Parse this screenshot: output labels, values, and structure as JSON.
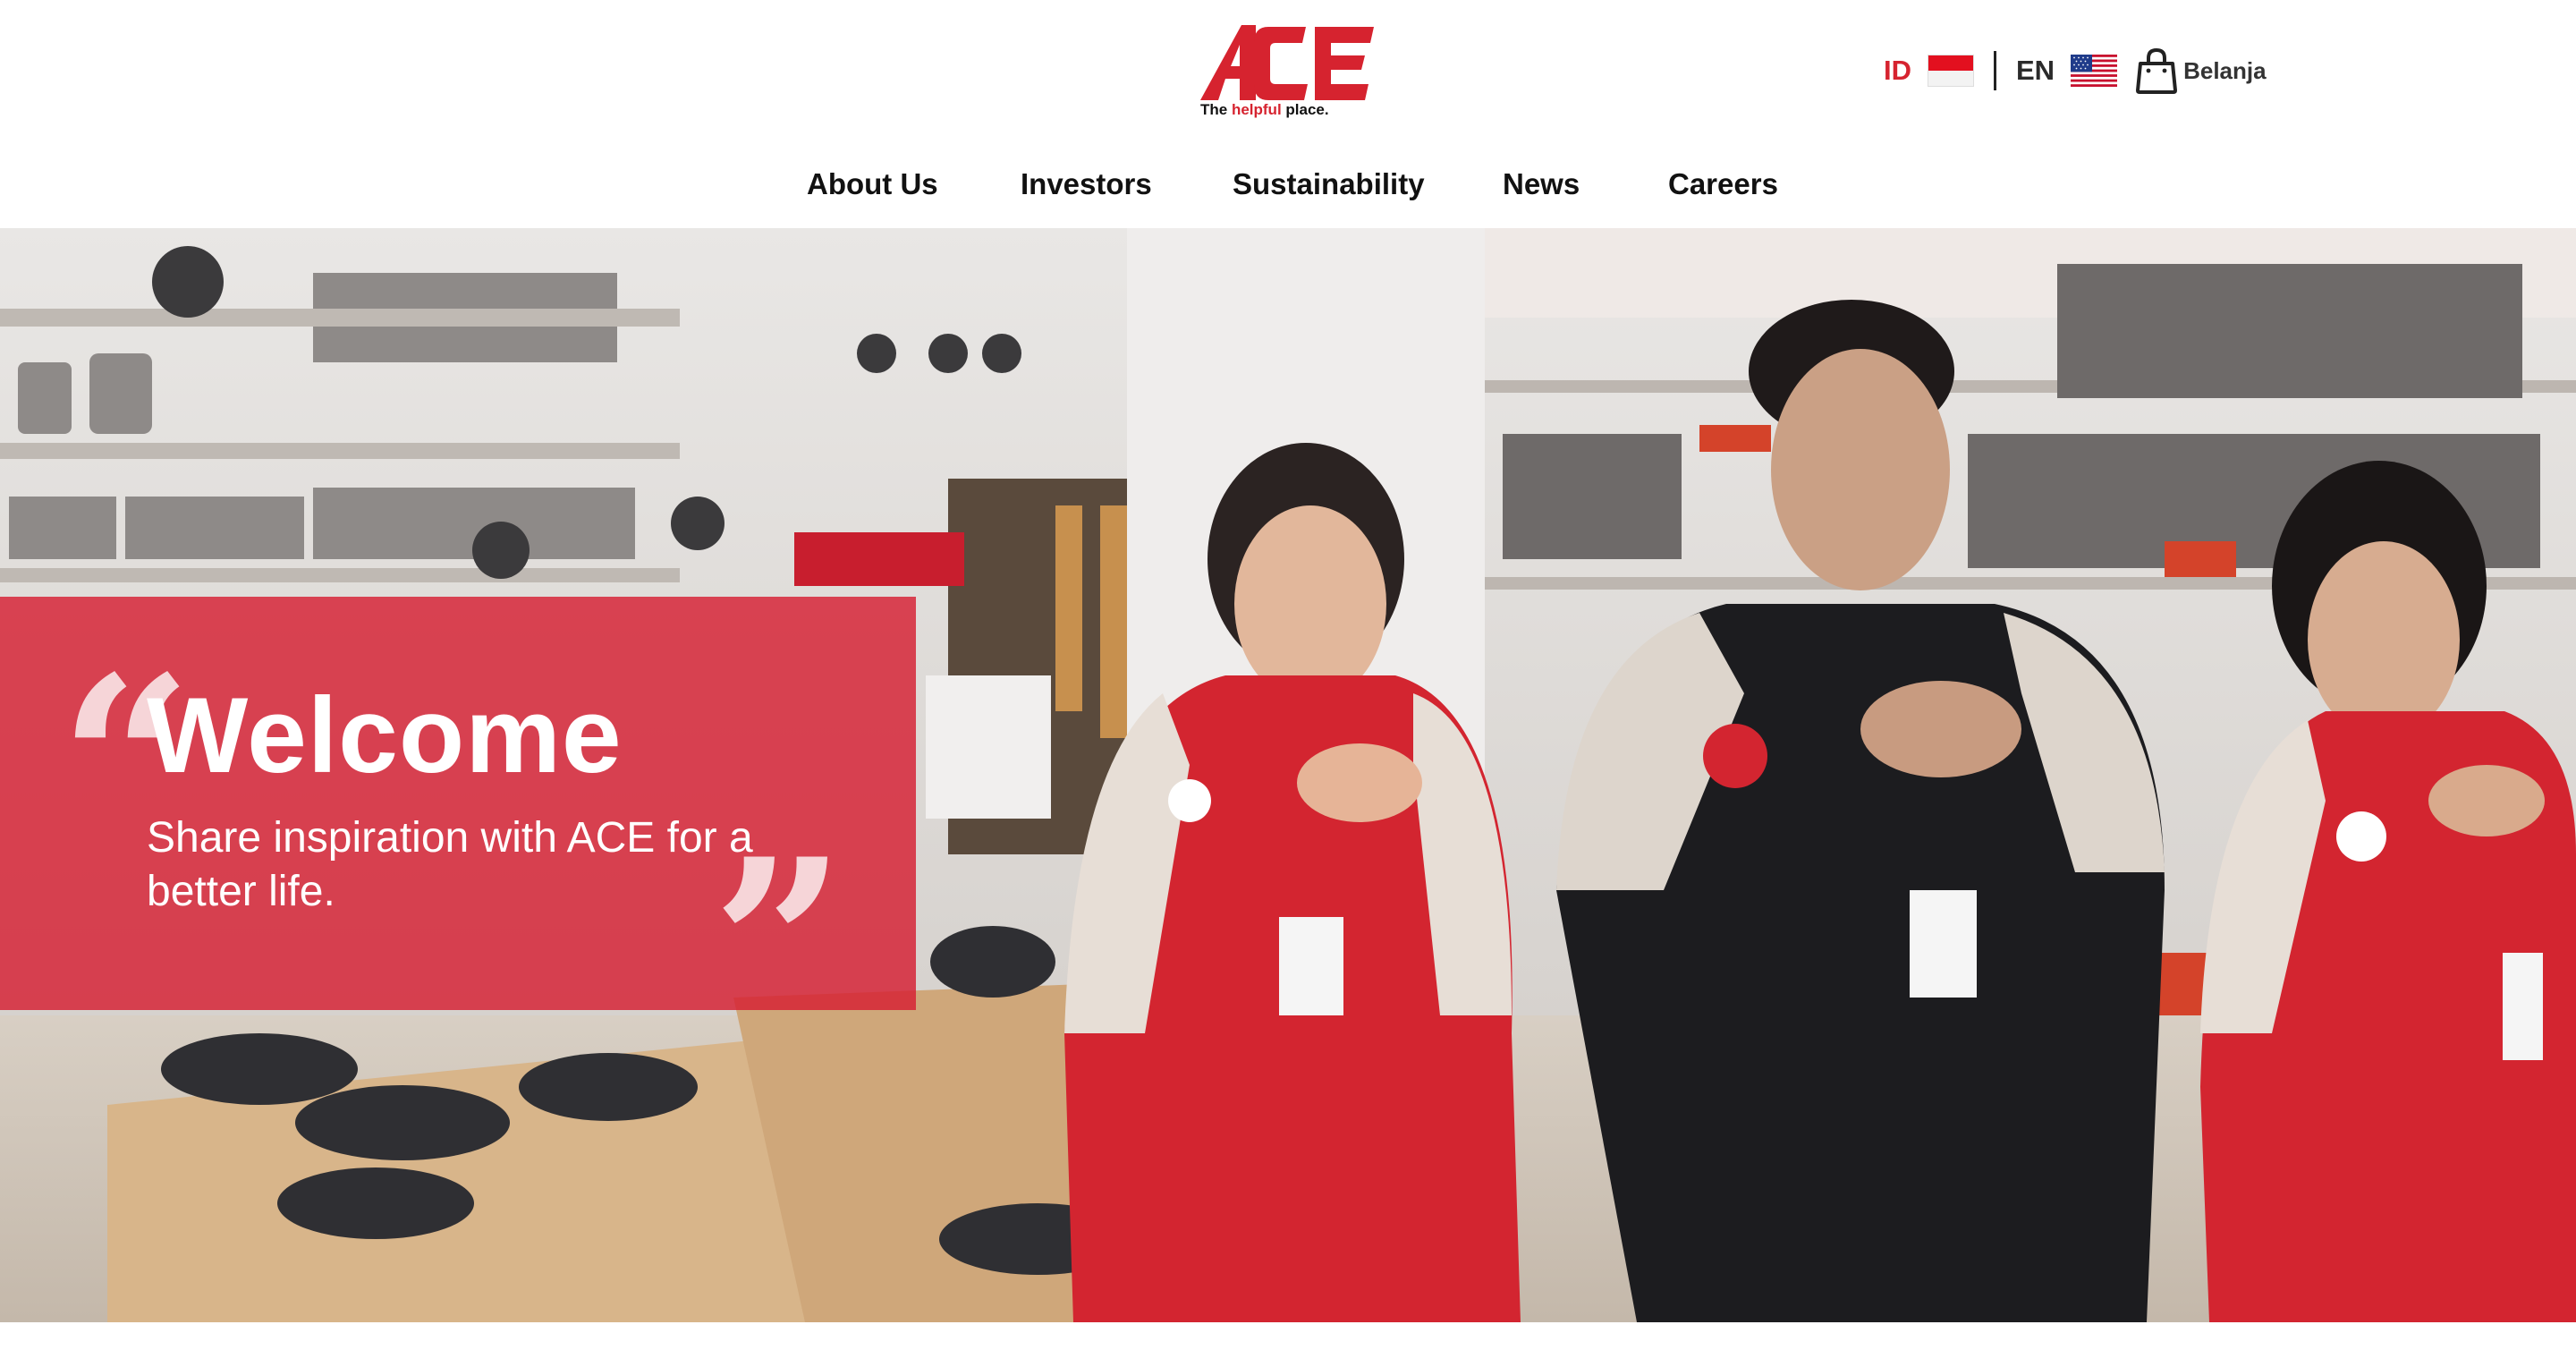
{
  "brand": {
    "logo_text": "ACE",
    "tagline_prefix": "The ",
    "tagline_highlight": "helpful",
    "tagline_suffix": " place.",
    "brand_red": "#d6232f"
  },
  "language": {
    "id_label": "ID",
    "en_label": "EN",
    "id_flag_icon": "indonesia-flag-icon",
    "en_flag_icon": "us-flag-icon"
  },
  "shop": {
    "label": "Belanja",
    "icon": "shopping-bag-icon"
  },
  "nav": {
    "items": [
      {
        "label": "About Us"
      },
      {
        "label": "Investors"
      },
      {
        "label": "Sustainability"
      },
      {
        "label": "News"
      },
      {
        "label": "Careers"
      }
    ]
  },
  "hero": {
    "open_quote": "“",
    "close_quote": "”",
    "title": "Welcome",
    "subtitle": "Share inspiration with ACE for a better life.",
    "overlay_color": "#d61e32"
  }
}
